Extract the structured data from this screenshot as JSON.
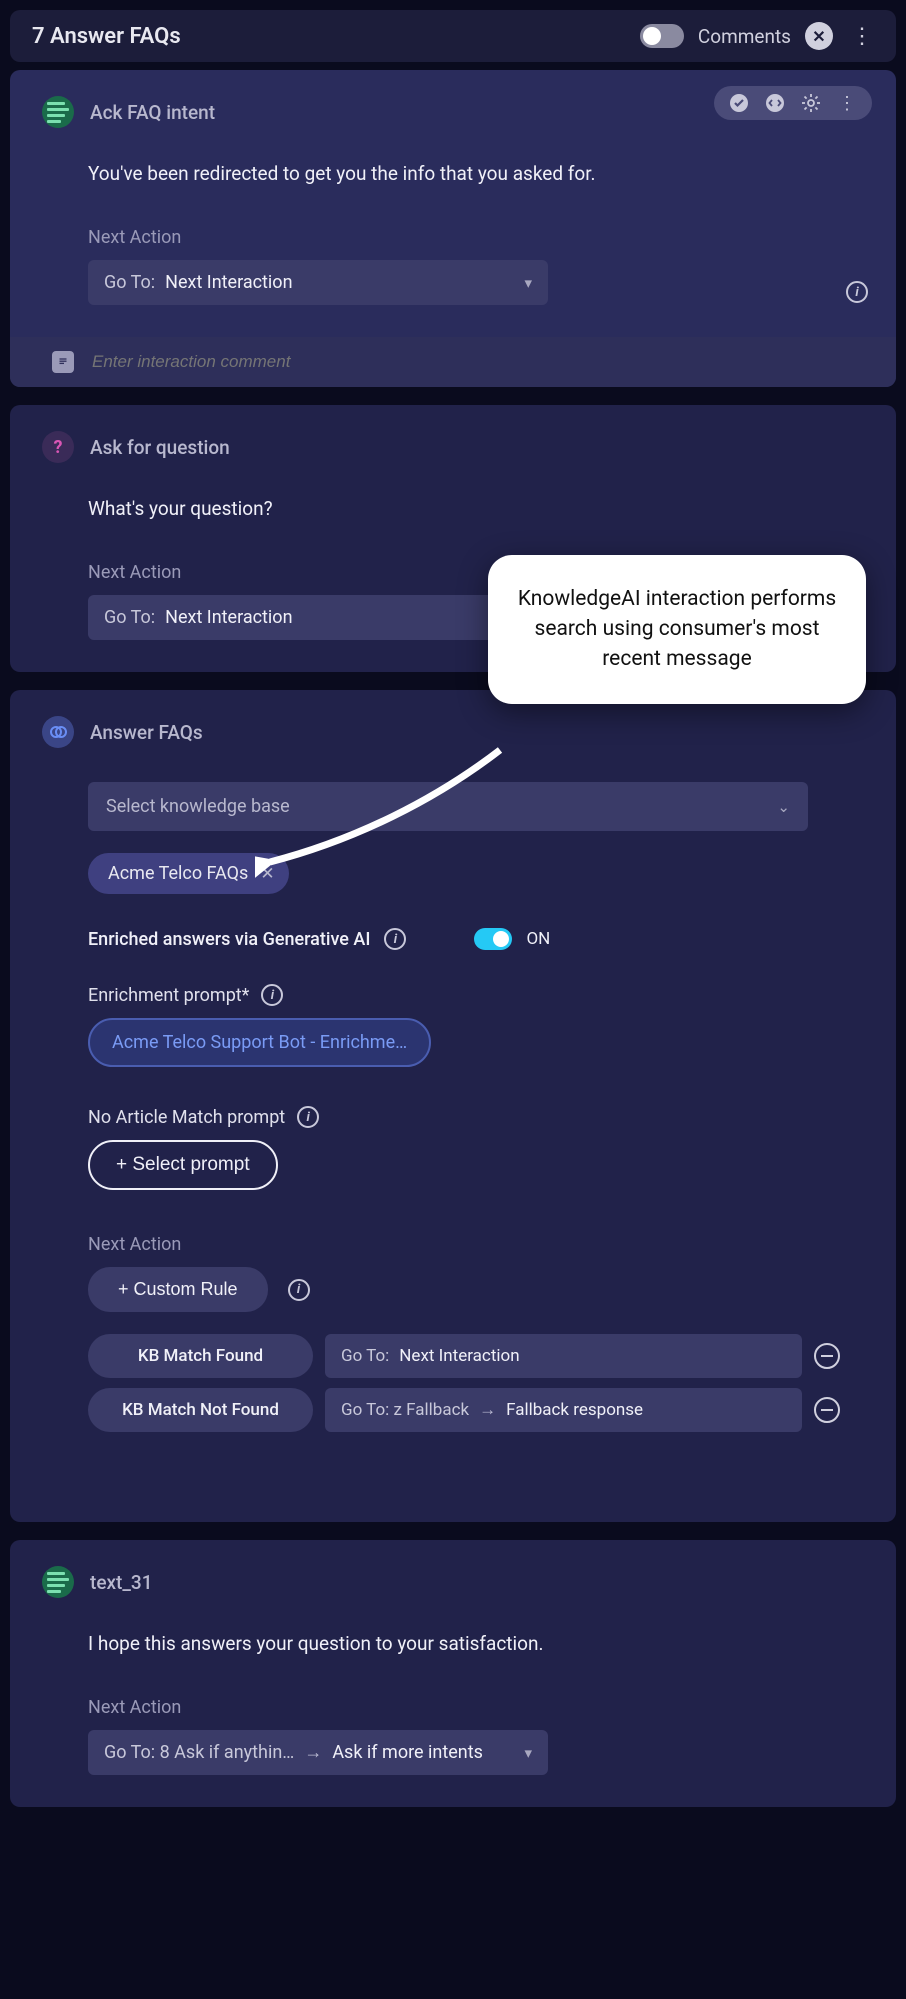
{
  "header": {
    "title": "7 Answer FAQs",
    "comments_label": "Comments"
  },
  "cards": {
    "ack": {
      "title": "Ack FAQ intent",
      "body": "You've been redirected to get you the info that you asked for.",
      "next_action_label": "Next Action",
      "goto_prefix": "Go To:",
      "goto_value": "Next Interaction",
      "comment_placeholder": "Enter interaction comment"
    },
    "ask": {
      "title": "Ask for question",
      "body": "What's your question?",
      "next_action_label": "Next Action",
      "goto_prefix": "Go To:",
      "goto_value": "Next Interaction"
    },
    "kb": {
      "title": "Answer FAQs",
      "select_placeholder": "Select knowledge base",
      "chip": "Acme Telco FAQs",
      "enriched_label": "Enriched answers via Generative AI",
      "enriched_state": "ON",
      "enrich_prompt_label": "Enrichment prompt*",
      "enrich_prompt_value": "Acme Telco Support Bot - Enrichme…",
      "no_match_label": "No Article Match prompt",
      "select_prompt_btn": "+ Select prompt",
      "next_action_label": "Next Action",
      "custom_rule_btn": "+ Custom Rule",
      "rule1_label": "KB Match Found",
      "rule1_goto_prefix": "Go To:",
      "rule1_goto_value": "Next Interaction",
      "rule2_label": "KB Match Not Found",
      "rule2_goto_prefix": "Go To: z Fallback",
      "rule2_target": "Fallback response"
    },
    "text31": {
      "title": "text_31",
      "body": "I hope this answers your question to your satisfaction.",
      "next_action_label": "Next Action",
      "goto_prefix": "Go To: 8 Ask if anythin…",
      "goto_value": "Ask if more intents"
    }
  },
  "callout": "KnowledgeAI interaction performs search using consumer's most recent message"
}
